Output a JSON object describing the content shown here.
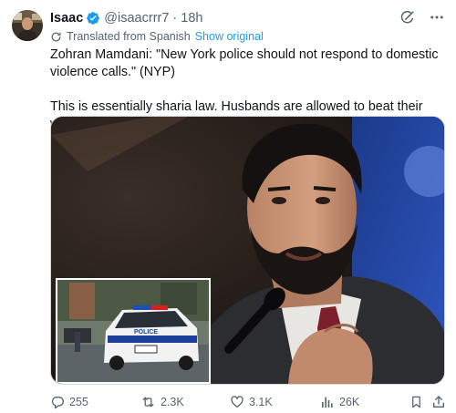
{
  "post": {
    "author": {
      "display_name": "Isaac",
      "handle": "@isaacrrr7",
      "verified": true,
      "avatar_icon": "user-avatar"
    },
    "separator": "·",
    "timestamp": "18h",
    "translation": {
      "label": "Translated from Spanish",
      "show_original": "Show original"
    },
    "text_lines": [
      "Zohran Mamdani: \"New York police should not respond to domestic violence calls.\" (NYP)",
      "This is essentially sharia law. Husbands are allowed to beat their wives."
    ],
    "media": {
      "inset_vehicle_text": "POLICE"
    },
    "metrics": {
      "replies": "255",
      "reposts": "2.3K",
      "likes": "3.1K",
      "views": "26K"
    }
  },
  "colors": {
    "accent": "#1d9bf0",
    "secondary_text": "#536471",
    "primary_text": "#0f1419",
    "border": "#cfd9de"
  },
  "icons": [
    "verified-badge-icon",
    "grok-icon",
    "more-icon",
    "globe-icon",
    "reply-icon",
    "repost-icon",
    "like-icon",
    "views-icon",
    "bookmark-icon",
    "share-icon"
  ]
}
